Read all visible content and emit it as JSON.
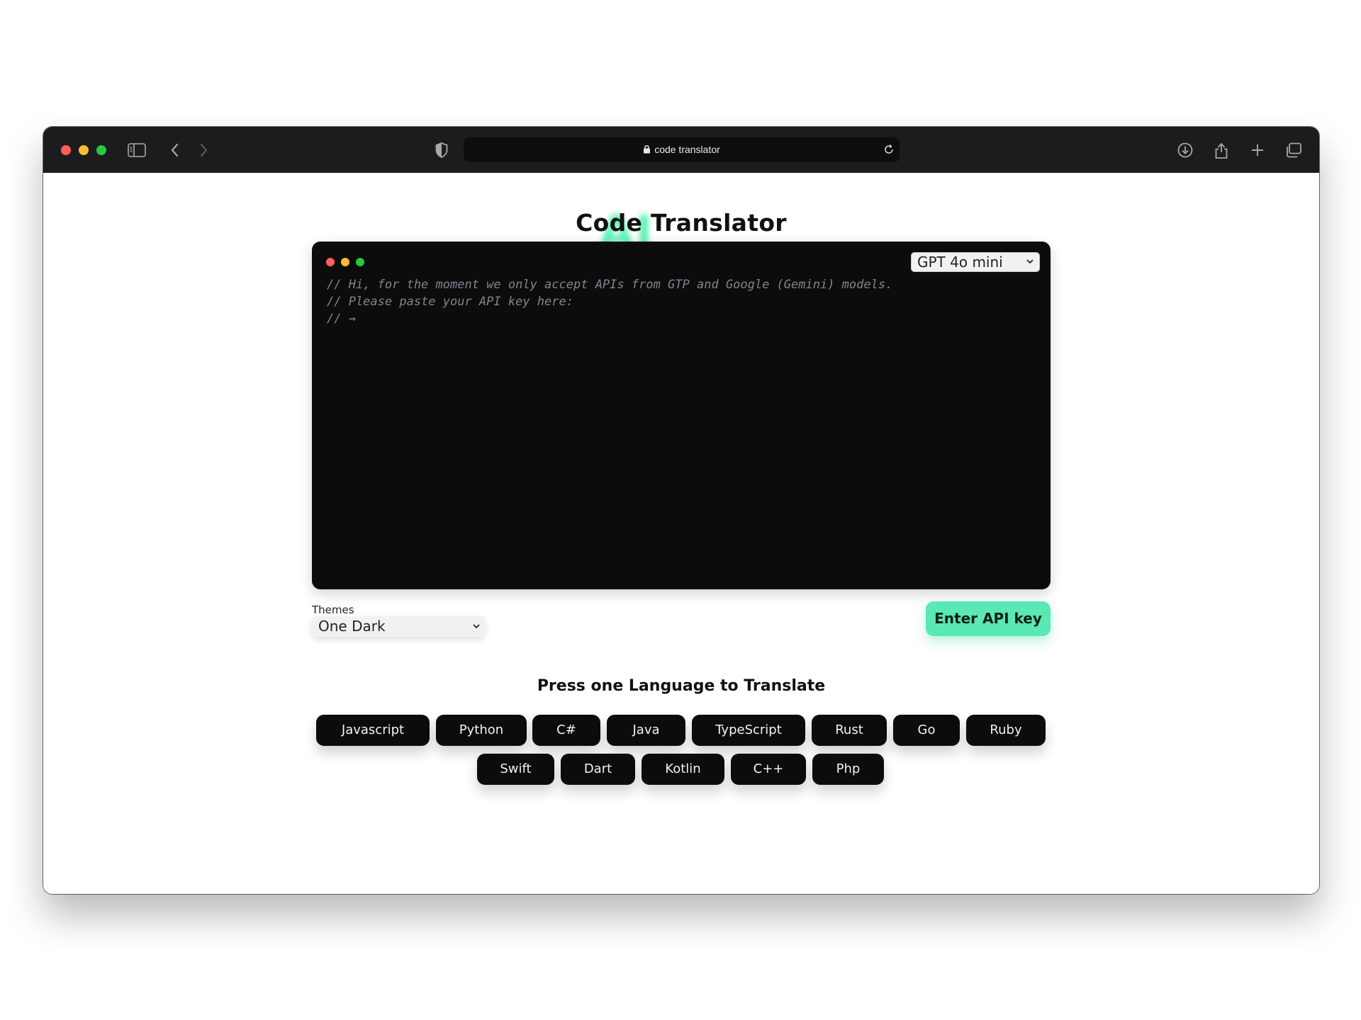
{
  "browser": {
    "url": "code translator",
    "traffic_colors": {
      "close": "#ff5f57",
      "minimize": "#febc2e",
      "zoom": "#28c840"
    }
  },
  "page": {
    "title_ai": "AI",
    "title": "Code Translator",
    "accent": "#5ae8b5"
  },
  "editor": {
    "model_selected": "GPT 4o mini",
    "code_lines": [
      "// Hi, for the moment we only accept APIs from GTP and Google (Gemini) models.",
      "// Please paste your API key here:",
      "// →"
    ]
  },
  "themes": {
    "label": "Themes",
    "selected": "One Dark"
  },
  "api_button": "Enter API key",
  "languages_heading": "Press one Language to Translate",
  "languages_row1": [
    "Javascript",
    "Python",
    "C#",
    "Java",
    "TypeScript",
    "Rust",
    "Go",
    "Ruby"
  ],
  "languages_row2": [
    "Swift",
    "Dart",
    "Kotlin",
    "C++",
    "Php"
  ]
}
